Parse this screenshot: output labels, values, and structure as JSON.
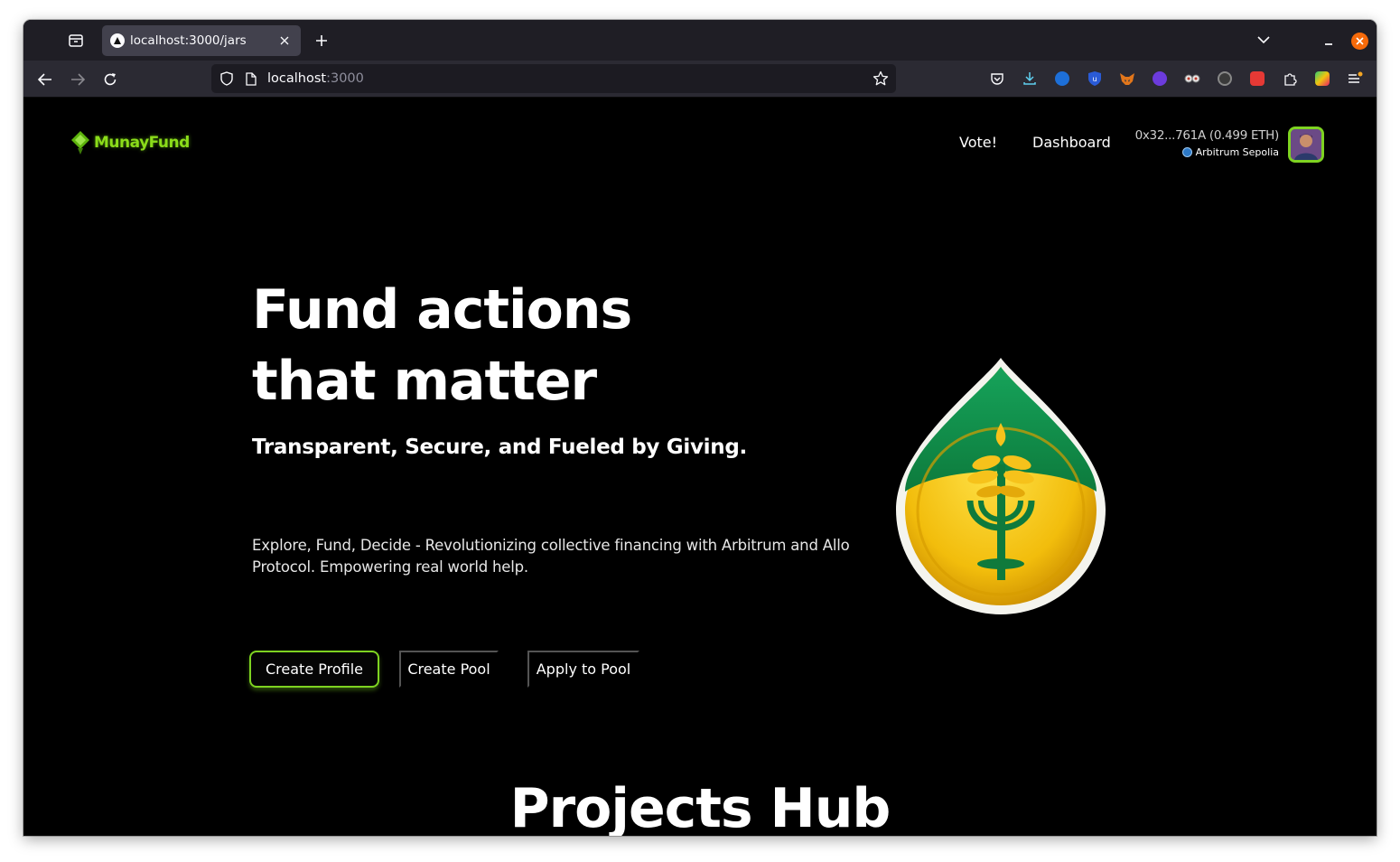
{
  "browser": {
    "tab": {
      "title": "localhost:3000/jars"
    },
    "url": {
      "host": "localhost",
      "port": ":3000"
    },
    "extensions": [
      {
        "name": "pocket-icon"
      },
      {
        "name": "downloads-icon"
      },
      {
        "name": "extension-blue-a-icon"
      },
      {
        "name": "ublock-icon"
      },
      {
        "name": "metamask-icon"
      },
      {
        "name": "extension-purple-face-icon"
      },
      {
        "name": "extension-goggles-icon"
      },
      {
        "name": "extension-dark-flower-icon"
      },
      {
        "name": "extension-red-icon"
      },
      {
        "name": "extensions-puzzle-icon"
      },
      {
        "name": "extension-colorful-icon"
      },
      {
        "name": "app-menu-icon"
      }
    ]
  },
  "header": {
    "brand": "MunayFund",
    "nav": {
      "vote": "Vote!",
      "dashboard": "Dashboard"
    },
    "wallet": {
      "address": "0x32...761A (0.499 ETH)",
      "network": "Arbitrum Sepolia"
    }
  },
  "hero": {
    "title": "Fund actions that matter",
    "subtitle": "Transparent, Secure, and Fueled by Giving.",
    "description": "Explore, Fund, Decide - Revolutionizing collective financing with Arbitrum and Allo Protocol. Empowering real world help.",
    "buttons": {
      "create_profile": "Create Profile",
      "create_pool": "Create Pool",
      "apply_pool": "Apply to Pool"
    }
  },
  "projects": {
    "heading": "Projects Hub"
  },
  "colors": {
    "accent": "#7ed321",
    "background": "#000000",
    "text": "#ffffff"
  }
}
